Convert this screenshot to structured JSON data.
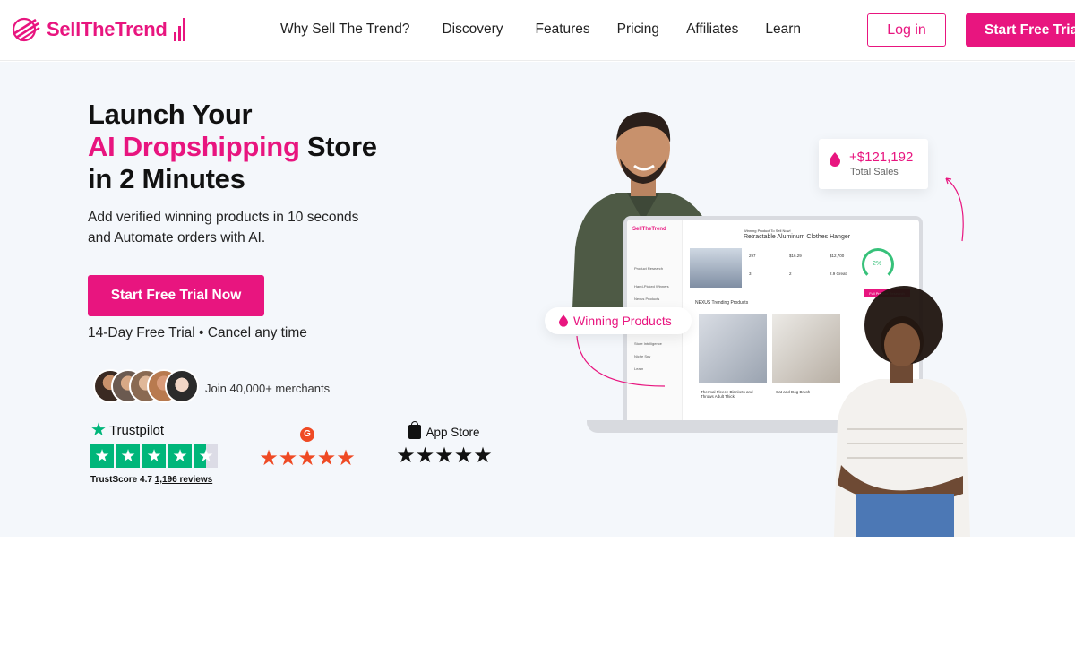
{
  "header": {
    "logo": {
      "part1": "Sell",
      "part2": "The",
      "part3": "Trend"
    },
    "nav": [
      "Why Sell The Trend?",
      "Discovery",
      "Features",
      "Pricing",
      "Affiliates",
      "Learn"
    ],
    "login_label": "Log in",
    "trial_label": "Start Free Trial"
  },
  "hero": {
    "title_line1": "Launch Your",
    "title_line2_accent": "AI Dropshipping",
    "title_line2_rest": " Store",
    "title_line3": "in 2 Minutes",
    "subtitle_line1": "Add verified winning products in 10 seconds",
    "subtitle_line2": "and Automate orders with AI.",
    "cta_label": "Start Free Trial Now",
    "trial_note": "14-Day Free Trial • Cancel any time",
    "merchants_text": "Join 40,000+ merchants"
  },
  "ratings": {
    "trustpilot": {
      "name": "Trustpilot",
      "score_label": "TrustScore 4.7",
      "reviews": "1,196 reviews",
      "stars": 4.5
    },
    "g2": {
      "stars": 5
    },
    "appstore": {
      "name": "App Store",
      "stars": 5
    }
  },
  "illustration": {
    "sales_value": "+$121,192",
    "sales_label": "Total Sales",
    "winning_label": "Winning Products",
    "laptop": {
      "logo": "SellTheTrend",
      "heading_small": "Winning Product To Sell Now!",
      "heading_large": "Retractable Aluminum Clothes Hanger",
      "stats": [
        "297",
        "$16.29",
        "$12,700",
        "3",
        "2",
        "2.9 Great"
      ],
      "gauge_value": "2%",
      "button_label": "Full Product Research",
      "section_title": "NEXUS Trending Products",
      "product1": "Thermal Fleece Blankets and Throws Adult Thick",
      "product2": "Cat and Dog Brush",
      "sidebar": [
        "Product Research",
        "Hand-Picked Winners",
        "Nexus Products",
        "Store Intelligence",
        "Niche Spy",
        "Learn"
      ]
    }
  },
  "colors": {
    "brand": "#e8157f",
    "trustpilot": "#00b67a",
    "g2": "#ef4a24",
    "hero_bg": "#f4f7fb"
  }
}
